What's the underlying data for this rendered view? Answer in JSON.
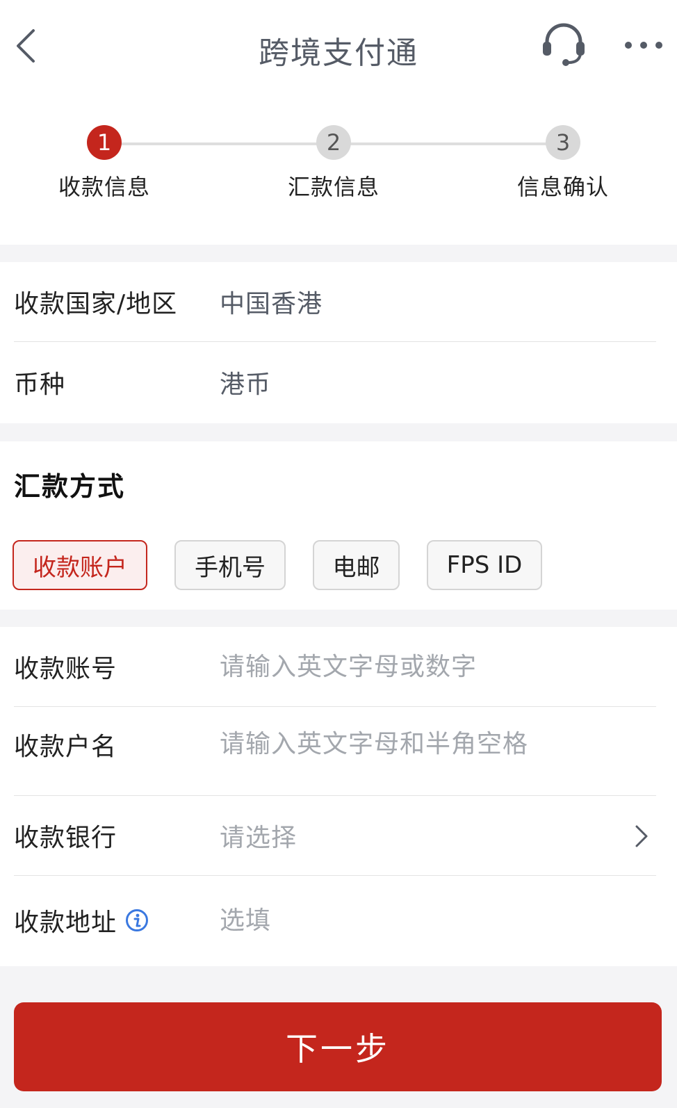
{
  "header": {
    "title": "跨境支付通",
    "back_icon": "chevron-left-icon",
    "support_icon": "headset-icon",
    "more_icon": "more-dots-icon"
  },
  "steps": [
    {
      "number": "1",
      "label": "收款信息",
      "active": true
    },
    {
      "number": "2",
      "label": "汇款信息",
      "active": false
    },
    {
      "number": "3",
      "label": "信息确认",
      "active": false
    }
  ],
  "region_section": {
    "country_label": "收款国家/地区",
    "country_value": "中国香港",
    "currency_label": "币种",
    "currency_value": "港币"
  },
  "method_section": {
    "title": "汇款方式",
    "options": [
      "收款账户",
      "手机号",
      "电邮",
      "FPS ID"
    ],
    "selected": "收款账户"
  },
  "form": {
    "account_label": "收款账号",
    "account_placeholder": "请输入英文字母或数字",
    "name_label": "收款户名",
    "name_placeholder": "请输入英文字母和半角空格",
    "bank_label": "收款银行",
    "bank_placeholder": "请选择",
    "address_label": "收款地址",
    "address_placeholder": "选填"
  },
  "next_button": "下一步",
  "colors": {
    "accent": "#c4261d",
    "info": "#3a78e0",
    "placeholder": "#a3a7ad",
    "background": "#f4f4f6"
  }
}
